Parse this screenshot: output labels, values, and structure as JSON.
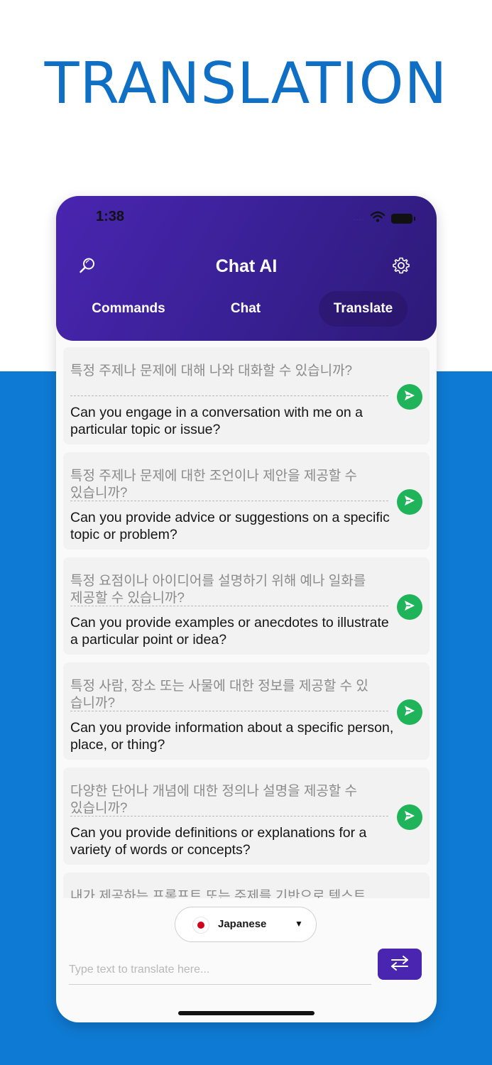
{
  "promo": {
    "title": "TRANSLATION"
  },
  "status": {
    "time": "1:38",
    "signal": "....",
    "icons": [
      "signal-dots",
      "wifi-icon",
      "battery-icon"
    ]
  },
  "header": {
    "title": "Chat AI",
    "left_icon": "search-icon",
    "right_icon": "gear-icon"
  },
  "tabs": [
    {
      "label": "Commands"
    },
    {
      "label": "Chat"
    },
    {
      "label": "Translate",
      "selected": true
    }
  ],
  "items": [
    {
      "source": "특정 주제나 문제에 대해 나와 대화할 수 있습니까?",
      "target": "Can you engage in a conversation with me on a particular topic or issue?"
    },
    {
      "source": "특정 주제나 문제에 대한 조언이나 제안을 제공할 수 있습니까?",
      "target": "Can you provide advice or suggestions on a specific topic or problem?"
    },
    {
      "source": "특정 요점이나 아이디어를 설명하기 위해 예나 일화를 제공할 수 있습니까?",
      "target": "Can you provide examples or anecdotes to illustrate a particular point or idea?"
    },
    {
      "source": "특정 사람, 장소 또는 사물에 대한 정보를 제공할 수 있습니까?",
      "target": "Can you provide information about a specific person, place, or thing?"
    },
    {
      "source": "다양한 단어나 개념에 대한 정의나 설명을 제공할 수 있습니까?",
      "target": "Can you provide definitions or explanations for a variety of words or concepts?"
    },
    {
      "source": "내가 제공하는 프롬프트 또는 주제를 기반으로 텍스트를",
      "target": ""
    }
  ],
  "language": {
    "selected": "Japanese",
    "flag": "japan-flag-icon",
    "caret": "▼"
  },
  "input": {
    "placeholder": "Type text to translate here..."
  },
  "colors": {
    "accent": "#4a25b0",
    "brand_blue": "#0f7ad3",
    "send_green": "#20b45a"
  }
}
